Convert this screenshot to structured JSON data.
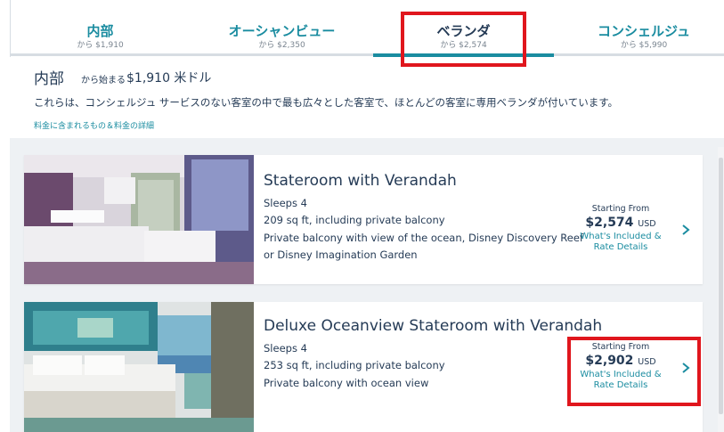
{
  "tabs": [
    {
      "label": "内部",
      "sub": "から $1,910"
    },
    {
      "label": "オーシャンビュー",
      "sub": "から $2,350"
    },
    {
      "label": "ベランダ",
      "sub": "から $2,574"
    },
    {
      "label": "コンシェルジュ",
      "sub": "から $5,990"
    }
  ],
  "intro": {
    "title": "内部",
    "from": "から始まる",
    "price": "$1,910 米ドル",
    "description": "これらは、コンシェルジュ サービスのない客室の中で最も広々とした客室で、ほとんどの客室に専用ベランダが付いています。",
    "link": "料金に含まれるもの＆料金の詳細"
  },
  "rooms": [
    {
      "title": "Stateroom with Verandah",
      "sleeps": "Sleeps 4",
      "size": "209 sq ft, including private balcony",
      "view1": "Private balcony with view of the ocean, Disney Discovery Reef",
      "view2": "or Disney Imagination Garden",
      "starting_from": "Starting From",
      "price": "$2,574",
      "currency": "USD",
      "link1": "What's Included &",
      "link2": "Rate Details"
    },
    {
      "title": "Deluxe Oceanview Stateroom with Verandah",
      "sleeps": "Sleeps 4",
      "size": "253 sq ft, including private balcony",
      "view1": "Private balcony with ocean view",
      "starting_from": "Starting From",
      "price": "$2,902",
      "currency": "USD",
      "link1": "What's Included &",
      "link2": "Rate Details"
    }
  ],
  "colors": {
    "accent": "#1a8ca0",
    "text": "#253b56",
    "highlight": "#e0161d"
  },
  "icons": {
    "chevron": "chevron-right-icon"
  }
}
